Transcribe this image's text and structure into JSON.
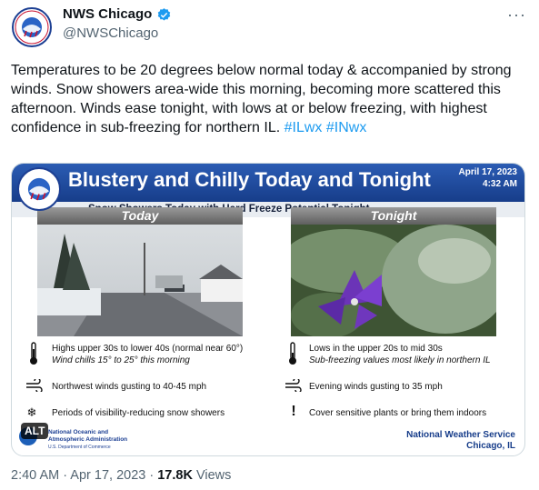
{
  "author": {
    "name": "NWS Chicago",
    "handle": "@NWSChicago"
  },
  "tweet": {
    "text": "Temperatures to be 20 degrees below normal today & accompanied by strong winds. Snow showers area-wide this morning, becoming more scattered this afternoon. Winds ease tonight, with lows at or below freezing, with highest confidence in sub-freezing for northern IL. ",
    "hashtags": [
      "#ILwx",
      "#INwx"
    ]
  },
  "graphic": {
    "title": "Blustery and Chilly Today and Tonight",
    "date": "April 17, 2023",
    "time": "4:32 AM",
    "subtitle": "Snow Showers Today with Hard Freeze Potential Tonight",
    "today": {
      "heading": "Today",
      "temp_line": "Highs upper 30s to lower 40s (normal near 60°)",
      "temp_sub": "Wind chills 15° to 25° this morning",
      "wind": "Northwest winds gusting to 40-45 mph",
      "snow": "Periods of visibility-reducing snow showers"
    },
    "tonight": {
      "heading": "Tonight",
      "temp_line": "Lows in the upper 20s to mid 30s",
      "temp_sub": "Sub-freezing values most likely in northern IL",
      "wind": "Evening winds gusting to 35 mph",
      "action": "Cover sensitive plants or bring them indoors"
    },
    "footer_left": [
      "National Oceanic and",
      "Atmospheric Administration",
      "U.S. Department of Commerce"
    ],
    "footer_right": [
      "National Weather Service",
      "Chicago, IL"
    ],
    "alt_label": "ALT"
  },
  "meta": {
    "time": "2:40 AM · Apr 17, 2023 · ",
    "views": "17.8K",
    "views_label": " Views"
  },
  "icons": {
    "more": "more-icon",
    "verified": "verified-badge-icon",
    "wind": "wind-icon",
    "snow": "snowflake-icon",
    "thermometer": "thermometer-icon",
    "exclamation": "exclamation-icon"
  },
  "colors": {
    "brand_blue": "#1c3f93",
    "link": "#1d9bf0",
    "verified": "#1d9bf0"
  }
}
